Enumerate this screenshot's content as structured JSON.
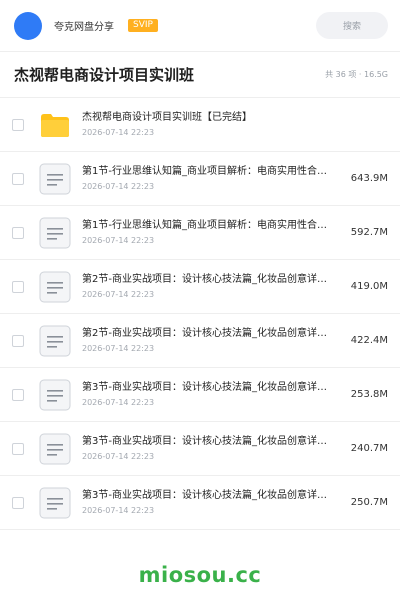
{
  "header": {
    "username": "夸克网盘分享",
    "badge": "SVIP",
    "search_label": "搜索"
  },
  "folder": {
    "title": "杰视帮电商设计项目实训班",
    "meta": "共 36 项 · 16.5G"
  },
  "files": [
    {
      "name": "杰视帮电商设计项目实训班【已完结】",
      "date": "2026-07-14 22:23",
      "size": "",
      "icon": "folder-icon"
    },
    {
      "name": "第1节-行业思维认知篇_商业项目解析：电商实用性合…",
      "date": "2026-07-14 22:23",
      "size": "643.9M",
      "icon": "document-icon"
    },
    {
      "name": "第1节-行业思维认知篇_商业项目解析：电商实用性合…",
      "date": "2026-07-14 22:23",
      "size": "592.7M",
      "icon": "document-icon"
    },
    {
      "name": "第2节-商业实战项目：设计核心技法篇_化妆品创意详…",
      "date": "2026-07-14 22:23",
      "size": "419.0M",
      "icon": "document-icon"
    },
    {
      "name": "第2节-商业实战项目：设计核心技法篇_化妆品创意详…",
      "date": "2026-07-14 22:23",
      "size": "422.4M",
      "icon": "document-icon"
    },
    {
      "name": "第3节-商业实战项目：设计核心技法篇_化妆品创意详…",
      "date": "2026-07-14 22:23",
      "size": "253.8M",
      "icon": "document-icon"
    },
    {
      "name": "第3节-商业实战项目：设计核心技法篇_化妆品创意详…",
      "date": "2026-07-14 22:23",
      "size": "240.7M",
      "icon": "document-icon"
    },
    {
      "name": "第3节-商业实战项目：设计核心技法篇_化妆品创意详…",
      "date": "2026-07-14 22:23",
      "size": "250.7M",
      "icon": "document-icon"
    }
  ],
  "watermark": "miosou.cc",
  "colors": {
    "avatar": "#2f7bf6",
    "badge": "#ffb020",
    "folder": "#ffc21a",
    "watermark": "#3ab14a"
  }
}
